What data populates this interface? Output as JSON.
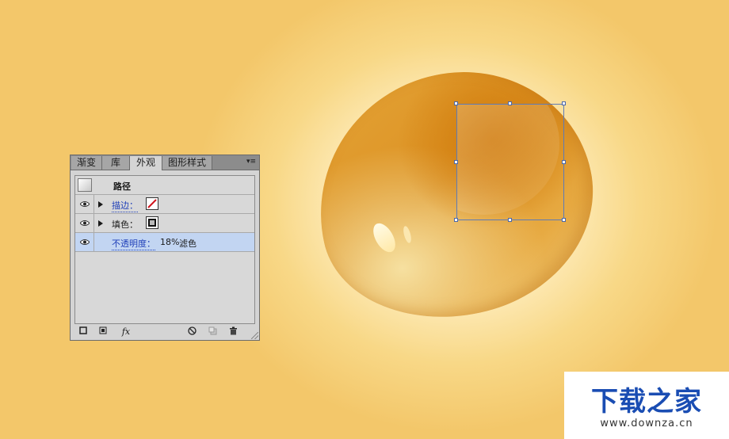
{
  "panel": {
    "tabs": [
      "渐变",
      "库",
      "外观",
      "图形样式"
    ],
    "active_tab": "外观",
    "menu_glyph": "▾≡",
    "header_label": "路径",
    "rows": [
      {
        "label": "描边：",
        "is_link": true
      },
      {
        "label": "填色：",
        "is_link": false
      },
      {
        "label": "不透明度：",
        "value": "18%",
        "mode": "滤色",
        "is_link": true,
        "selected": true
      }
    ],
    "footer": {
      "fx_label": "fx"
    }
  },
  "colors": {
    "background": "#f3c76a",
    "egg_base": "#dc9224",
    "selection": "#c2d5f2",
    "link": "#1f3fb8"
  },
  "icons": [
    "eye-icon",
    "expand-triangle-icon",
    "stroke-swatch-icon",
    "fill-swatch-icon",
    "add-stroke-icon",
    "add-fill-icon",
    "fx-icon",
    "clear-icon",
    "duplicate-icon",
    "trash-icon"
  ],
  "watermark": {
    "title": "下载之家",
    "url": "www.downza.cn"
  }
}
